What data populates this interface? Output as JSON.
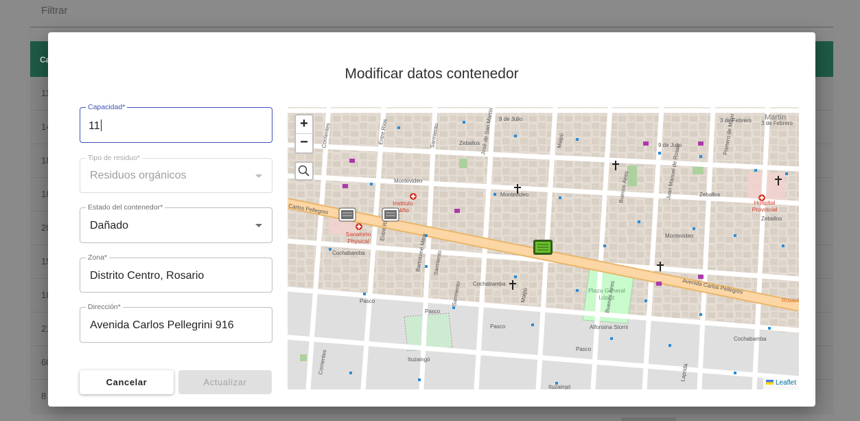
{
  "background": {
    "filter_label": "Filtrar",
    "table_header_fragment": "Ca",
    "row_fragments": [
      "11",
      "14",
      "18",
      "18",
      "20",
      "15",
      "18",
      "21",
      "60",
      "8"
    ]
  },
  "modal": {
    "title": "Modificar datos contenedor",
    "fields": {
      "capacidad": {
        "label": "Capacidad*",
        "value": "11"
      },
      "tipo_residuo": {
        "label": "Tipo de residuo*",
        "value": "Residuos orgánicos"
      },
      "estado": {
        "label": "Estado del contenedor*",
        "value": "Dañado"
      },
      "zona": {
        "label": "Zona*",
        "value": "Distrito Centro, Rosario"
      },
      "direccion": {
        "label": "Dirección*",
        "value": "Avenida Carlos Pellegrini 916"
      }
    },
    "buttons": {
      "cancel": "Cancelar",
      "update": "Actualizar"
    }
  },
  "map": {
    "zoom_in": "+",
    "zoom_out": "−",
    "attribution": "Leaflet",
    "labels": {
      "carlos_pellegrini_w": "Carlos Pellegrini",
      "carlos_pellegrini_e": "Avenida Carlos Pellegrini",
      "instituto": "Instituto",
      "nino": "Niño",
      "sanatorio": "Sanatorio",
      "physical": "Physical",
      "hospital": "Hospital",
      "provincial": "Provincial",
      "plaza1": "Plaza General",
      "plaza2": "López",
      "martin": "Martín",
      "nueve_julio_w": "9 de Julio",
      "nueve_julio_e": "9 de Julio",
      "tres_febrero": "3 de Febrero",
      "tres_febrero_2": "3 de Febrero",
      "zeballos_w": "Zeballos",
      "zeballos_e": "Zeballos",
      "zeballos_far": "Zeballos",
      "montevideo_w": "Montevideo",
      "montevideo_m": "Montevideo",
      "montevideo_e": "Montevideo",
      "cochabamba_w": "Cochabamba",
      "cochabamba_m": "Cochabamba",
      "cochabamba_e": "Cochabamba",
      "pasco_w": "Pasco",
      "pasco_m": "Pasco",
      "pasco_e": "Pasco",
      "pasco_m2": "Pasco",
      "ituzaingo": "Ituzaingó",
      "ituzaingo_e": "Ituzaingó",
      "alfonsina": "Alfonsina Storni",
      "corrientes": "Corrientes",
      "corrientes_s": "Corrientes",
      "entre_rios": "Entre Ríos",
      "entre_rios_s": "Entre Ríos",
      "sarmiento": "Sarmiento",
      "sarmiento_s": "Sarmiento",
      "sarmiento_s2": "Sarmiento",
      "san_martin": "José de San Martín",
      "maipu": "Maipú",
      "maipu_s": "Maipú",
      "buenos_aires": "Buenos Aires",
      "buenos_aires_s": "Buenos Aires",
      "juan_manuel": "Juan Manuel de Rosas",
      "primero_mayo": "Primero de Mayo",
      "bartolome_mitre": "Bartolomé Mitre",
      "laprida": "Laprida",
      "rosario": "Rosario"
    }
  },
  "colors": {
    "primary": "#3f51b5",
    "header_dimmed": "#1f5a45",
    "map_avenue": "#f7c97a",
    "bin_gray": "#6e6e6e",
    "bin_green": "#6bbf2a"
  }
}
